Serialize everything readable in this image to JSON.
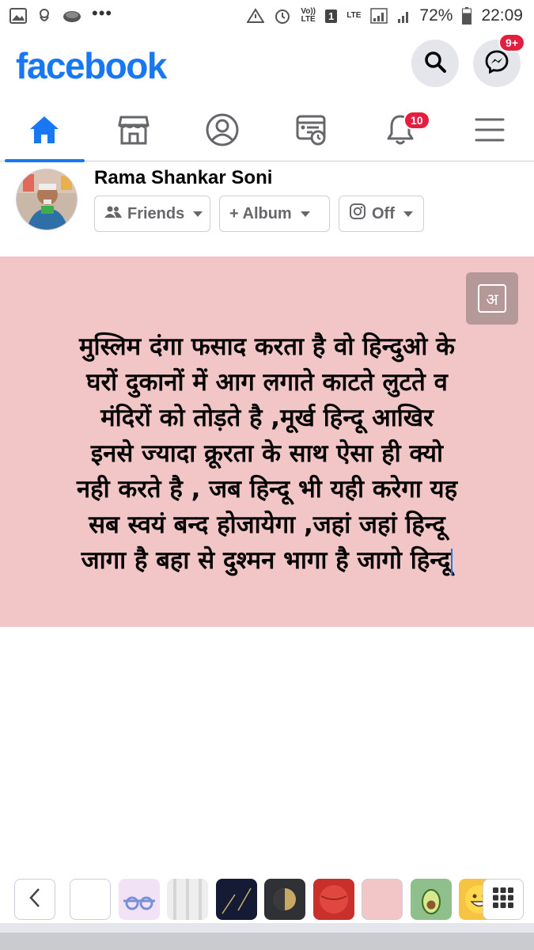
{
  "status_bar": {
    "icons_left": [
      "gallery-icon",
      "bird-icon",
      "cloud-icon"
    ],
    "more": "•••",
    "volte": "Vo))\nLTE",
    "sim": "1",
    "lte": "LTE",
    "battery_percent": "72%",
    "time": "22:09"
  },
  "header": {
    "logo": "facebook",
    "messenger_badge": "9+"
  },
  "nav": {
    "tabs": [
      {
        "name": "home",
        "active": true
      },
      {
        "name": "marketplace"
      },
      {
        "name": "profile"
      },
      {
        "name": "memories"
      },
      {
        "name": "notifications",
        "badge": "10"
      },
      {
        "name": "menu"
      }
    ]
  },
  "composer": {
    "author": "Rama Shankar Soni",
    "audience_label": "Friends",
    "album_label": "+ Album",
    "instagram_label": "Off"
  },
  "post": {
    "background_color": "#f2c6c6",
    "font_button_glyph": "अ",
    "lines": [
      "मुस्लिम दंगा फसाद करता है वो हिन्दुओ के",
      "घरों दुकानों में आग लगाते काटते लुटते व",
      "मंदिरों को तोड़ते है ,मूर्ख हिन्दू आखिर",
      "इनसे ज्यादा क्रूरता के साथ ऐसा ही क्यो",
      "नही करते है , जब हिन्दू भी यही करेगा यह",
      "सब स्वयं बन्द होजायेगा ,जहां जहां हिन्दू",
      "जागा है बहा से दुश्मन भागा है जागो हिन्दू"
    ]
  },
  "background_picker": {
    "swatches": [
      {
        "name": "white",
        "color": "#ffffff"
      },
      {
        "name": "sunglasses",
        "color": "#f1e3f5"
      },
      {
        "name": "pattern-white",
        "color": "#eeeeee"
      },
      {
        "name": "night-sky",
        "color": "#151b35"
      },
      {
        "name": "moon",
        "color": "#2f3134"
      },
      {
        "name": "red-ball",
        "color": "#c9302c"
      },
      {
        "name": "pink",
        "color": "#f2c6c6"
      },
      {
        "name": "avocado",
        "color": "#8fbf8a"
      },
      {
        "name": "emoji",
        "color": "#f6c343"
      }
    ]
  }
}
